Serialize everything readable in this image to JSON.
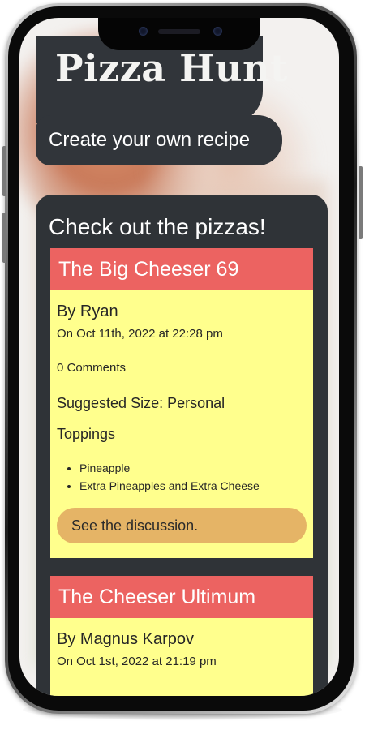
{
  "app": {
    "logo_text": "Pizza Hunt",
    "create_button_label": "Create your own recipe"
  },
  "panel": {
    "title": "Check out the pizzas!"
  },
  "pizzas": [
    {
      "name": "The Big Cheeser 69",
      "author": "By Ryan",
      "date": "On Oct 11th, 2022 at 22:28 pm",
      "comments": "0 Comments",
      "size": "Suggested Size: Personal",
      "toppings_label": "Toppings",
      "toppings": [
        "Pineapple",
        "Extra Pineapples and Extra Cheese"
      ],
      "discussion_label": "See the discussion."
    },
    {
      "name": "The Cheeser Ultimum",
      "author": "By Magnus Karpov",
      "date": "On Oct 1st, 2022 at 21:19 pm"
    }
  ],
  "colors": {
    "dark_panel": "#2f3337",
    "card_header": "#ec6361",
    "card_body": "#ffff8d",
    "discussion_button": "#e5b466"
  }
}
